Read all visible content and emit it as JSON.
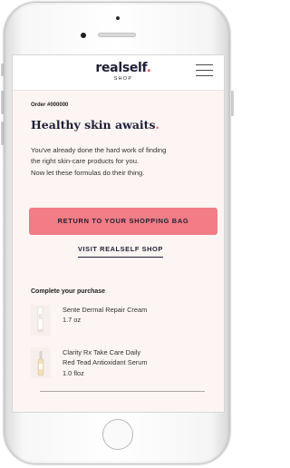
{
  "header": {
    "logo_text": "realself",
    "logo_dot": ".",
    "logo_sub": "SHOP",
    "menu_icon": "hamburger-icon"
  },
  "order": {
    "label": "Order #000000"
  },
  "hero": {
    "headline": "Healthy skin awaits",
    "headline_dot": "."
  },
  "body_lines": [
    "You've already done the hard work of finding",
    "the right skin-care products for you.",
    "Now let these formulas do their thing."
  ],
  "actions": {
    "return_label": "RETURN TO YOUR SHOPPING BAG",
    "visit_label": "VISIT REALSELF SHOP"
  },
  "purchase": {
    "title": "Complete your purchase",
    "products": [
      {
        "name_lines": [
          "Sente Dermal Repair Cream"
        ],
        "size": "1.7 oz"
      },
      {
        "name_lines": [
          "Clarity Rx Take Care Daily",
          "Red Tead Antioxidant Serum"
        ],
        "size": "1.0 floz"
      }
    ]
  },
  "colors": {
    "accent": "#f27d86",
    "brand_dot": "#e1585e",
    "navy": "#1f1f36",
    "screen_bg": "#fcf5f3"
  }
}
